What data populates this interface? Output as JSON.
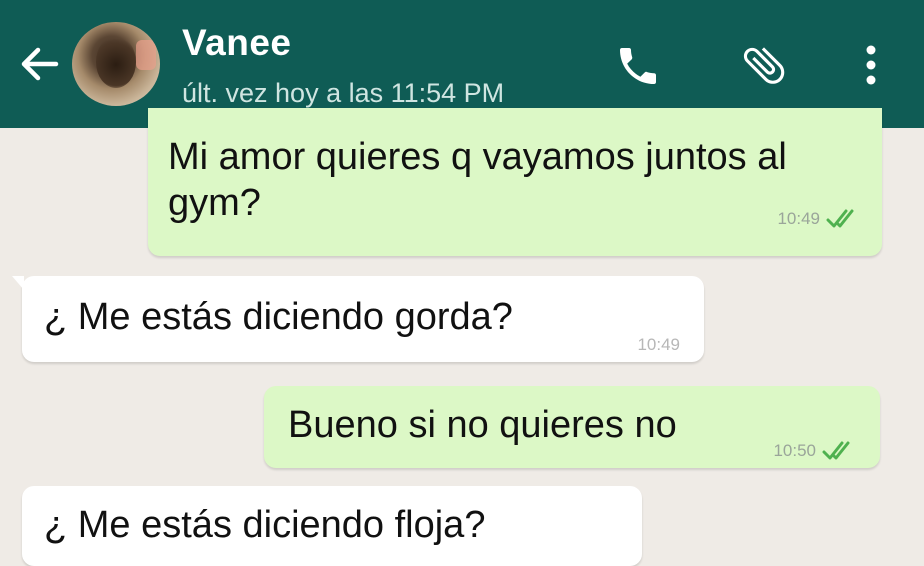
{
  "header": {
    "contact_name": "Vanee",
    "last_seen": "últ. vez hoy a las 11:54 PM",
    "icons": [
      "back-arrow-icon",
      "avatar",
      "phone-icon",
      "paperclip-icon",
      "more-vert-icon"
    ],
    "bg_color": "#0f5c55"
  },
  "messages": [
    {
      "direction": "outgoing",
      "lines": [
        "Mi amor quieres q vayamos juntos al",
        "gym?"
      ],
      "time": "10:49",
      "status": "read"
    },
    {
      "direction": "incoming",
      "text": "¿ Me estás diciendo gorda?",
      "time": "10:49"
    },
    {
      "direction": "outgoing",
      "text": "Bueno si no quieres no",
      "time": "10:50",
      "status": "read"
    },
    {
      "direction": "incoming",
      "text": "¿ Me estás diciendo floja?"
    }
  ],
  "colors": {
    "chat_background": "#efebe6",
    "outgoing_bubble": "#dcf8c6",
    "incoming_bubble": "#ffffff",
    "read_ticks": "#4fb14f"
  }
}
